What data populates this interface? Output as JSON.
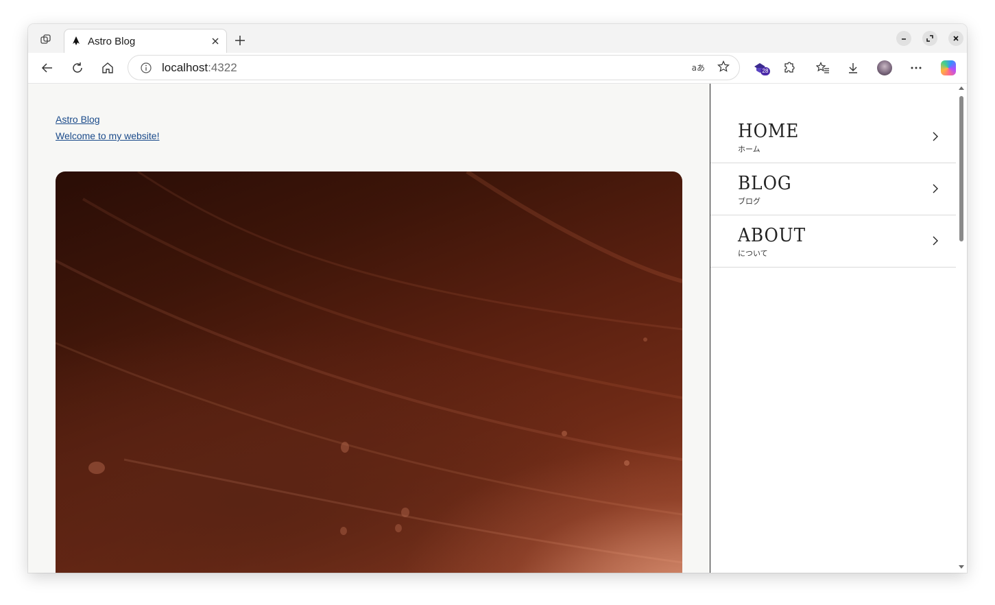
{
  "browser": {
    "tab": {
      "title": "Astro Blog"
    },
    "address": {
      "host": "localhost",
      "port": ":4322"
    },
    "extension_badge": "28",
    "read_aloud_label": "aあ"
  },
  "page": {
    "site_title": "Astro Blog",
    "welcome_link": "Welcome to my website!",
    "hero_image_alt": "",
    "nav": [
      {
        "en": "HOME",
        "jp": "ホーム"
      },
      {
        "en": "BLOG",
        "jp": "ブログ"
      },
      {
        "en": "ABOUT",
        "jp": "について"
      }
    ]
  },
  "icons": {
    "workspaces": "workspaces-icon",
    "back": "back-arrow-icon",
    "refresh": "refresh-icon",
    "home": "home-icon",
    "info": "info-icon",
    "favorite": "star-icon",
    "extensions": "puzzle-icon",
    "favorites": "favorites-icon",
    "downloads": "download-icon",
    "more": "more-icon"
  },
  "colors": {
    "page_background": "#f7f7f5",
    "link": "#1a4a8a",
    "nav_border": "#222222",
    "badge": "#4b2aa8"
  }
}
